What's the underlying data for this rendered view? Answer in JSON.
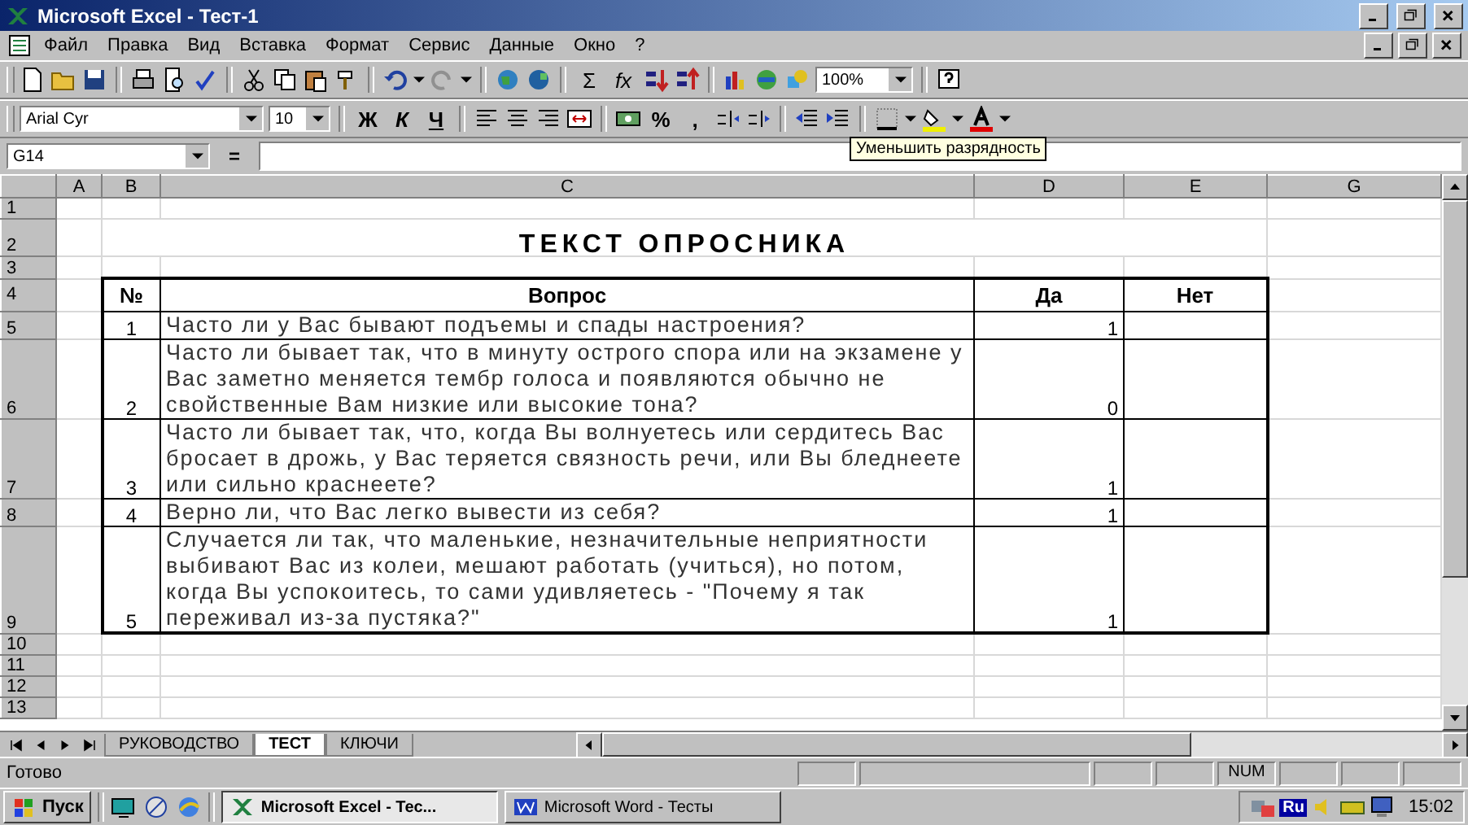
{
  "window": {
    "title": "Microsoft Excel - Тест-1"
  },
  "menu": [
    "Файл",
    "Правка",
    "Вид",
    "Вставка",
    "Формат",
    "Сервис",
    "Данные",
    "Окно",
    "?"
  ],
  "standard_toolbar": {
    "sum": "Σ",
    "function": "fx",
    "zoom": "100%"
  },
  "formatting_toolbar": {
    "font": "Arial Cyr",
    "size": "10",
    "bold": "Ж",
    "italic": "К",
    "underline": "Ч",
    "percent": "%",
    "comma": ",",
    "tooltip": "Уменьшить разрядность"
  },
  "formula_bar": {
    "name_box": "G14",
    "equals": "="
  },
  "sheet": {
    "columns": [
      "A",
      "B",
      "C",
      "D",
      "E",
      "G"
    ],
    "row_numbers": [
      "1",
      "2",
      "3",
      "4",
      "5",
      "6",
      "7",
      "8",
      "9",
      "10",
      "11",
      "12",
      "13"
    ],
    "title": "ТЕКСТ ОПРОСНИКА",
    "header": {
      "number": "№",
      "question": "Вопрос",
      "yes": "Да",
      "no": "Нет"
    },
    "questions": [
      {
        "number": "1",
        "text": "Часто ли у Вас бывают подъемы и спады настроения?",
        "yes": "1"
      },
      {
        "number": "2",
        "text": "Часто ли бывает так, что в минуту острого спора или на экзамене у Вас заметно меняется тембр голоса и появляются обычно не свойственные Вам низкие или высокие тона?",
        "yes": "0"
      },
      {
        "number": "3",
        "text": "Часто ли бывает так, что, когда Вы волнуетесь или сердитесь Вас бросает в дрожь, у Вас теряется связность речи, или Вы бледнеете или сильно краснеете?",
        "yes": "1"
      },
      {
        "number": "4",
        "text": "Верно ли, что Вас легко вывести из себя?",
        "yes": "1"
      },
      {
        "number": "5",
        "text": "Случается ли так, что маленькие, незначительные неприятности выбивают Вас из колеи, мешают работать (учиться), но потом, когда Вы успокоитесь, то сами удивляетесь - \"Почему я так переживал из-за пустяка?\"",
        "yes": "1"
      }
    ]
  },
  "sheet_tabs": [
    {
      "label": "РУКОВОДСТВО",
      "selected": false
    },
    {
      "label": "ТЕСТ",
      "selected": true
    },
    {
      "label": "КЛЮЧИ",
      "selected": false
    }
  ],
  "status_bar": {
    "status": "Готово",
    "indicator": "NUM"
  },
  "taskbar": {
    "start": "Пуск",
    "tasks": [
      {
        "label": "Microsoft Excel - Тес...",
        "selected": true
      },
      {
        "label": "Microsoft Word - Тесты",
        "selected": false
      }
    ],
    "language": "Ru",
    "clock": "15:02"
  }
}
